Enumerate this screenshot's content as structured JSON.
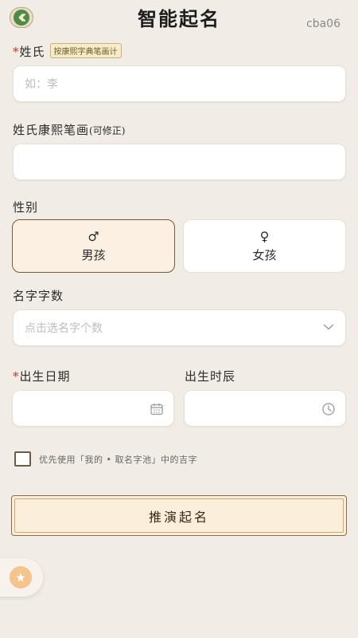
{
  "header": {
    "title": "智能起名",
    "code": "cba06"
  },
  "surname": {
    "label": "姓氏",
    "required_mark": "*",
    "badge": "按康熙字典笔画计",
    "placeholder": "如：李",
    "value": ""
  },
  "strokes": {
    "label": "姓氏康熙笔画",
    "note": "(可修正)",
    "value": ""
  },
  "gender": {
    "label": "性别",
    "options": [
      {
        "label": "男孩",
        "symbol": "♂",
        "selected": true
      },
      {
        "label": "女孩",
        "symbol": "♀",
        "selected": false
      }
    ]
  },
  "name_length": {
    "label": "名字字数",
    "placeholder": "点击选名字个数"
  },
  "birth_date": {
    "label": "出生日期",
    "required_mark": "*",
    "value": ""
  },
  "birth_hour": {
    "label": "出生时辰",
    "value": ""
  },
  "prefer_pool": {
    "label": "优先使用「我的 • 取名字池」中的吉字",
    "checked": false
  },
  "submit": {
    "label": "推演起名"
  },
  "colors": {
    "background": "#f1ede6",
    "accent_border": "#7b5a33",
    "selected_fill": "#fbf0e1",
    "required": "#c0392b",
    "back_button": "#4f8a4a"
  }
}
